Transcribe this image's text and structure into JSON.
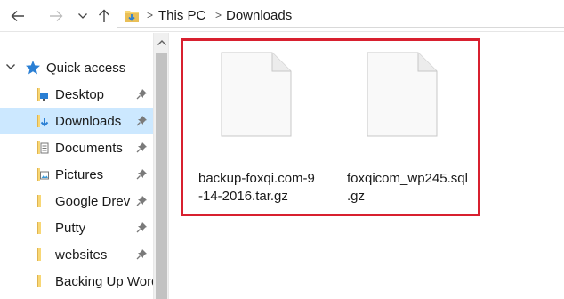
{
  "address_bar": {
    "breadcrumbs": [
      "This PC",
      "Downloads"
    ],
    "separator": ">",
    "icons": {
      "back": "arrow-left-icon",
      "forward": "arrow-right-icon",
      "recent": "chevron-down-icon",
      "up": "arrow-up-icon",
      "location": "downloads-folder-icon"
    }
  },
  "nav_pane": {
    "quick_access": {
      "label": "Quick access",
      "icon": "star-icon",
      "expanded": true
    },
    "items": [
      {
        "label": "Desktop",
        "icon": "desktop-folder-icon",
        "pinned": true,
        "selected": false
      },
      {
        "label": "Downloads",
        "icon": "downloads-folder-icon",
        "pinned": true,
        "selected": true
      },
      {
        "label": "Documents",
        "icon": "documents-folder-icon",
        "pinned": true,
        "selected": false
      },
      {
        "label": "Pictures",
        "icon": "pictures-folder-icon",
        "pinned": true,
        "selected": false
      },
      {
        "label": "Google Drev",
        "icon": "folder-icon",
        "pinned": true,
        "selected": false
      },
      {
        "label": "Putty",
        "icon": "folder-icon",
        "pinned": true,
        "selected": false
      },
      {
        "label": "websites",
        "icon": "folder-icon",
        "pinned": true,
        "selected": false
      },
      {
        "label": "Backing Up Word",
        "icon": "folder-icon",
        "pinned": false,
        "selected": false
      }
    ]
  },
  "content": {
    "files": [
      {
        "name": "backup-foxqi.com-9-14-2016.tar.gz",
        "name_lines": [
          "backup-foxqi.com-9",
          "-14-2016.tar.gz"
        ],
        "icon": "blank-file-icon"
      },
      {
        "name": "foxqicom_wp245.sql.gz",
        "name_lines": [
          "foxqicom_wp245.sql",
          ".gz"
        ],
        "icon": "blank-file-icon"
      }
    ],
    "highlight_color": "#d8202f"
  },
  "colors": {
    "selection": "#cce8ff",
    "folder_yellow": "#f8d775",
    "folder_dark": "#e0b450",
    "star_blue": "#2a7fd4",
    "scrollbar_thumb": "#c2c2c2"
  }
}
